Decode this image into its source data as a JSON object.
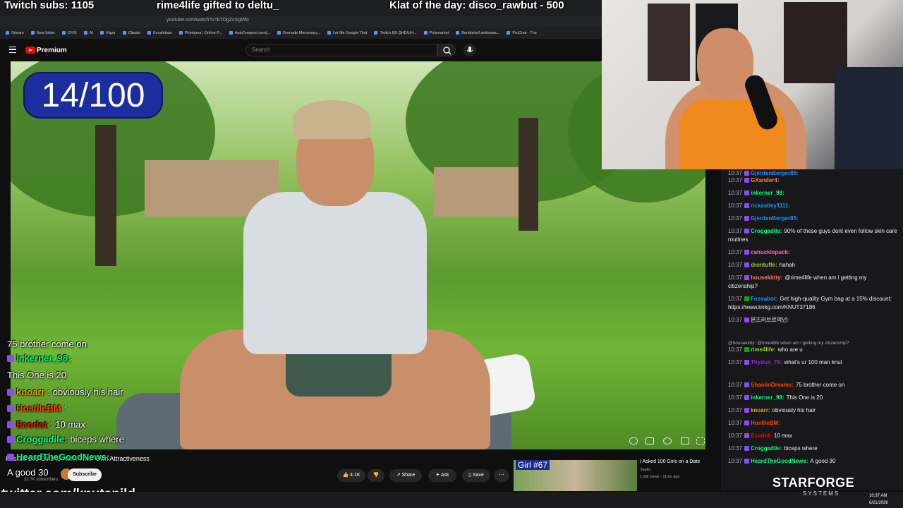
{
  "overlay": {
    "twitch_subs": "Twitch subs: 1105",
    "gifted": "rime4life gifted to deltu_",
    "klat": "Klat of the day: disco_rawbut - 500",
    "counter": "14/100",
    "twitter": "twitter.com/knutspild",
    "brand": "STARFORGE",
    "brand_sub": "SYSTEMS"
  },
  "browser": {
    "url": "youtube.com/watch?v=kTOgZsSgMfo",
    "bookmarks": [
      "Stream",
      "New folder",
      "GYM",
      "AI",
      "Viiger",
      "Claude",
      "Excalidraw",
      "Photopea | Online P...",
      "AutoTempest.com|...",
      "Grenade Mercenary...",
      "Let Me Google That",
      "Twitch EB QHD/UH...",
      "Polymarket",
      "Bombshell ambassa...",
      "ProChat - The"
    ]
  },
  "youtube": {
    "brand": "Premium",
    "search_placeholder": "Search",
    "video_title": "I Asked 100 Girls to Rank Their Own Attractiveness",
    "subs": "32.7K subscribers",
    "subscribe": "Subscribe",
    "likes": "4.1K",
    "share": "Share",
    "ask": "Ask",
    "save": "Save",
    "rec_label": "Girl #67",
    "rec_title": "I Asked 100 Girls on a Date",
    "rec_channel": "Sayko",
    "rec_meta": "1.2M views · 11mo ago"
  },
  "overlay_chat": [
    {
      "user": "",
      "text": "75 brother come on",
      "color": "#ffffff"
    },
    {
      "user": "inkerner_98:",
      "text": "",
      "color": "#00ff7f"
    },
    {
      "user": "",
      "text": "This One is 20",
      "color": "#ffffff"
    },
    {
      "user": "knoarr",
      "text": ": obviously his hair",
      "color": "#daa520"
    },
    {
      "user": "HostileBM",
      "text": ":",
      "color": "#ff4500"
    },
    {
      "user": "Ecodot",
      "text": ": 10 max",
      "color": "#ff0000"
    },
    {
      "user": "Croggadile:",
      "text": "biceps where",
      "color": "#00ff7f"
    },
    {
      "user": "HeardTheGoodNews:",
      "text": "",
      "color": "#00ff7f"
    },
    {
      "user": "",
      "text": "A good 30",
      "color": "#ffffff"
    }
  ],
  "chat": [
    {
      "time": "10:37",
      "user": "GjerdenBerger85:",
      "text": "",
      "color": "#1e90ff",
      "badge": "#9147ff"
    },
    {
      "time": "10:37",
      "user": "GXander4:",
      "text": "",
      "color": "#ff7f50",
      "badge": "#9147ff"
    },
    {
      "time": "10:37",
      "user": "inkerner_98:",
      "text": "",
      "color": "#00ff7f",
      "badge": "#9147ff"
    },
    {
      "time": "10:37",
      "user": "rickastley1111:",
      "text": "",
      "color": "#1e90ff",
      "badge": "#9147ff"
    },
    {
      "time": "10:37",
      "user": "GjerdenBerger85:",
      "text": "",
      "color": "#1e90ff",
      "badge": "#9147ff"
    },
    {
      "time": "10:37",
      "user": "Croggadile:",
      "text": "90% of these guys dont even follow skin care routines",
      "color": "#00ff7f",
      "badge": "#9147ff"
    },
    {
      "time": "10:37",
      "user": "canucklepuck:",
      "text": "",
      "color": "#ff69b4",
      "badge": "#9147ff"
    },
    {
      "time": "10:37",
      "user": "drontuffe:",
      "text": "hahah",
      "color": "#9acd32",
      "badge": "#9147ff"
    },
    {
      "time": "10:37",
      "user": "housekittty:",
      "text": "@rime4life when am i getting my citizenship?",
      "color": "#ff7f50",
      "badge": "#9147ff"
    },
    {
      "time": "10:37",
      "user": "Fossabot:",
      "text": "Get high-quality Gym bag at a 15% discount: https://www.knkg.com/KNUT37186",
      "color": "#1e90ff",
      "badge": "#00ad03"
    },
    {
      "time": "10:37",
      "user": "본즈러브르억넌:",
      "text": "",
      "color": "#adadb8",
      "badge": "#9147ff"
    },
    {
      "time": "",
      "user": "",
      "text": "@housekittty: @rime4life when am i getting my citizenship?",
      "color": "#adadb8",
      "badge": ""
    },
    {
      "time": "10:37",
      "user": "rime4life:",
      "text": "who are u",
      "color": "#9acd32",
      "badge": "#00ad03"
    },
    {
      "time": "10:37",
      "user": "Thydus_76:",
      "text": "what's ur 100 man knut",
      "color": "#8a2be2",
      "badge": "#9147ff"
    },
    {
      "time": "10:37",
      "user": "ShaolinDreams:",
      "text": "75 brother come on",
      "color": "#ff4500",
      "badge": "#9147ff"
    },
    {
      "time": "10:37",
      "user": "inkerner_98:",
      "text": "This One is 20",
      "color": "#00ff7f",
      "badge": "#9147ff"
    },
    {
      "time": "10:37",
      "user": "knoarr:",
      "text": "obviously his hair",
      "color": "#daa520",
      "badge": "#9147ff"
    },
    {
      "time": "10:37",
      "user": "HostileBM:",
      "text": "",
      "color": "#ff4500",
      "badge": "#9147ff"
    },
    {
      "time": "10:37",
      "user": "Ecodot:",
      "text": "10 max",
      "color": "#ff0000",
      "badge": "#9147ff"
    },
    {
      "time": "10:37",
      "user": "Croggadile:",
      "text": "biceps where",
      "color": "#00ff7f",
      "badge": "#9147ff"
    },
    {
      "time": "10:37",
      "user": "HeardTheGoodNews:",
      "text": "A good 30",
      "color": "#00ff7f",
      "badge": "#9147ff"
    }
  ],
  "taskbar": {
    "time": "10:37 AM",
    "date": "6/21/2026"
  }
}
